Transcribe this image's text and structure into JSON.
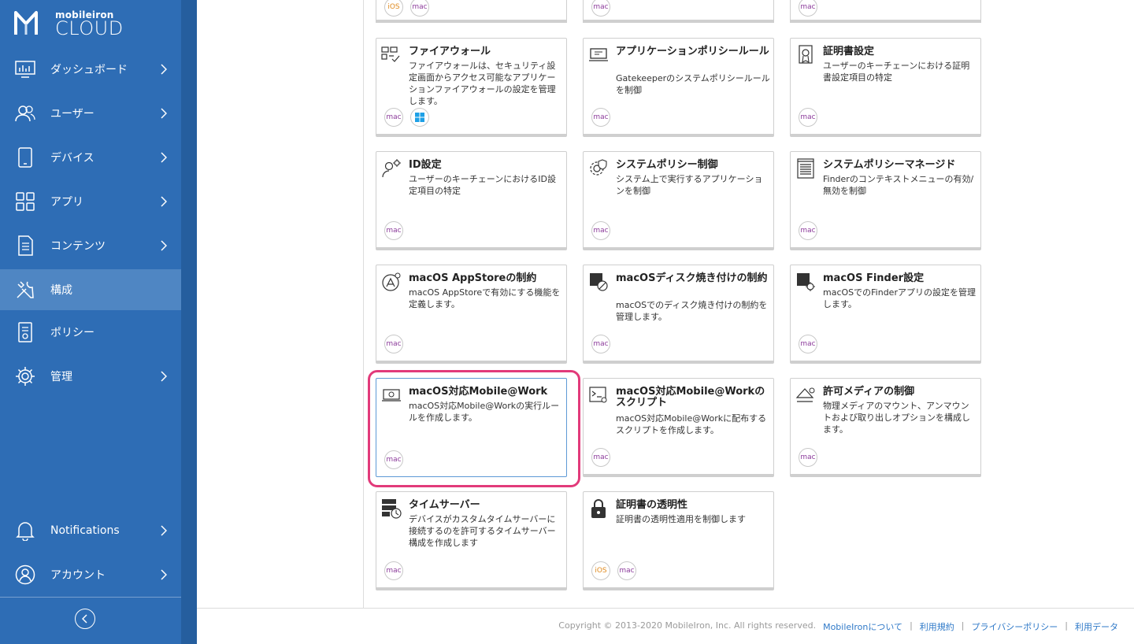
{
  "app": {
    "logo_small": "mobileiron",
    "logo_big": "CLOUD"
  },
  "sidebar": {
    "items": [
      {
        "label": "ダッシュボード",
        "icon": "dashboard-icon",
        "chevron": true
      },
      {
        "label": "ユーザー",
        "icon": "users-icon",
        "chevron": true
      },
      {
        "label": "デバイス",
        "icon": "device-icon",
        "chevron": true
      },
      {
        "label": "アプリ",
        "icon": "apps-icon",
        "chevron": true
      },
      {
        "label": "コンテンツ",
        "icon": "content-icon",
        "chevron": true
      },
      {
        "label": "構成",
        "icon": "configuration-icon",
        "chevron": false,
        "active": true
      },
      {
        "label": "ポリシー",
        "icon": "policy-icon",
        "chevron": false
      },
      {
        "label": "管理",
        "icon": "admin-gear-icon",
        "chevron": true
      }
    ],
    "bottom_items": [
      {
        "label": "Notifications",
        "icon": "bell-icon"
      },
      {
        "label": "アカウント",
        "icon": "account-icon"
      }
    ]
  },
  "partial_row": [
    {
      "badges": [
        "iOS",
        "mac"
      ]
    },
    {
      "badges": [
        "mac"
      ]
    },
    {
      "badges": [
        "mac"
      ]
    }
  ],
  "cards": [
    {
      "title": "ファイアウォール",
      "desc": "ファイアウォールは、セキュリティ設定画面からアクセス可能なアプリケーションファイアウォールの設定を管理します。",
      "icon": "firewall-icon",
      "badges": [
        "mac",
        "win"
      ]
    },
    {
      "title": "アプリケーションポリシールール",
      "desc": "Gatekeeperのシステムポリシールールを制御",
      "icon": "app-policy-icon",
      "badges": [
        "mac"
      ]
    },
    {
      "title": "証明書設定",
      "desc": "ユーザーのキーチェーンにおける証明書設定項目の特定",
      "icon": "certificate-icon",
      "badges": [
        "mac"
      ]
    },
    {
      "title": "ID設定",
      "desc": "ユーザーのキーチェーンにおけるID設定項目の特定",
      "icon": "identity-icon",
      "badges": [
        "mac"
      ]
    },
    {
      "title": "システムポリシー制御",
      "desc": "システム上で実行するアプリケーションを制御",
      "icon": "system-policy-gear-icon",
      "badges": [
        "mac"
      ]
    },
    {
      "title": "システムポリシーマネージド",
      "desc": "Finderのコンテキストメニューの有効/無効を制御",
      "icon": "managed-list-icon",
      "badges": [
        "mac"
      ]
    },
    {
      "title": "macOS AppStoreの制約",
      "desc": "macOS AppStoreで有効にする機能を定義します。",
      "icon": "appstore-icon",
      "badges": [
        "mac"
      ]
    },
    {
      "title": "macOSディスク焼き付けの制約",
      "desc": "macOSでのディスク焼き付けの制約を管理します。",
      "icon": "disc-burn-icon",
      "badges": [
        "mac"
      ]
    },
    {
      "title": "macOS Finder設定",
      "desc": "macOSでのFinderアプリの設定を管理します。",
      "icon": "finder-icon",
      "badges": [
        "mac"
      ]
    },
    {
      "title": "macOS対応Mobile@Work",
      "desc": "macOS対応Mobile@Workの実行ルールを作成します。",
      "icon": "laptop-gear-icon",
      "badges": [
        "mac"
      ],
      "selected": true
    },
    {
      "title": "macOS対応Mobile@Workのスクリプト",
      "desc": "macOS対応Mobile@Workに配布するスクリプトを作成します。",
      "icon": "script-terminal-icon",
      "badges": [
        "mac"
      ]
    },
    {
      "title": "許可メディアの制御",
      "desc": "物理メディアのマウント、アンマウントおよび取り出しオプションを構成します。",
      "icon": "eject-gear-icon",
      "badges": [
        "mac"
      ]
    },
    {
      "title": "タイムサーバー",
      "desc": "デバイスがカスタムタイムサーバーに接続するのを許可するタイムサーバー構成を作成します",
      "icon": "time-server-icon",
      "badges": [
        "mac"
      ]
    },
    {
      "title": "証明書の透明性",
      "desc": "証明書の透明性適用を制御します",
      "icon": "lock-icon",
      "badges": [
        "iOS",
        "mac"
      ]
    }
  ],
  "footer": {
    "copyright": "Copyright © 2013-2020 MobileIron, Inc. All rights reserved.",
    "links": [
      "MobileIronについて",
      "利用規約",
      "プライバシーポリシー",
      "利用データ"
    ]
  }
}
